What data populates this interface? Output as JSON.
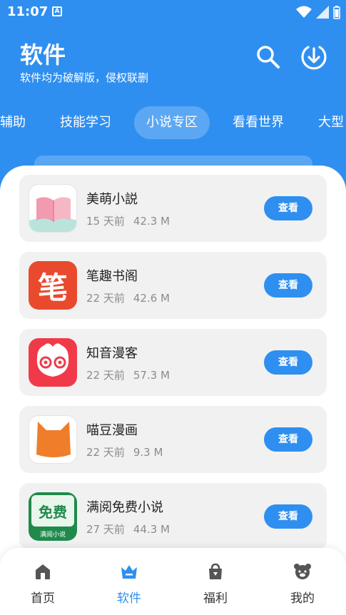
{
  "status_bar": {
    "time": "11:07",
    "notification_icon": "A"
  },
  "header": {
    "title": "软件",
    "subtitle": "软件均为破解版，侵权联删",
    "icons": [
      "search-icon",
      "download-icon"
    ]
  },
  "tabs": [
    "辅助",
    "技能学习",
    "小说专区",
    "看看世界",
    "大型"
  ],
  "active_tab": "小说专区",
  "apps": [
    {
      "name": "美萌小説",
      "age": "15 天前",
      "size": "42.3 M",
      "action": "查看"
    },
    {
      "name": "笔趣书阁",
      "age": "22 天前",
      "size": "42.6 M",
      "action": "查看"
    },
    {
      "name": "知音漫客",
      "age": "22 天前",
      "size": "57.3 M",
      "action": "查看"
    },
    {
      "name": "喵豆漫画",
      "age": "22 天前",
      "size": "9.3 M",
      "action": "查看"
    },
    {
      "name": "满阅免费小说",
      "age": "27 天前",
      "size": "44.3 M",
      "action": "查看"
    }
  ],
  "app_icon_text": {
    "biqu": "笔",
    "manyue_badge": "免费",
    "manyue_caption": "满阅小说"
  },
  "bottom_nav": [
    {
      "label": "首页",
      "icon": "home-icon"
    },
    {
      "label": "软件",
      "icon": "crown-icon"
    },
    {
      "label": "福利",
      "icon": "gift-bag-icon"
    },
    {
      "label": "我的",
      "icon": "bear-face-icon"
    }
  ],
  "active_nav": "软件",
  "colors": {
    "primary": "#2f8ff0",
    "card_bg": "#f1f1f1",
    "meta_text": "#8c8c8c"
  }
}
